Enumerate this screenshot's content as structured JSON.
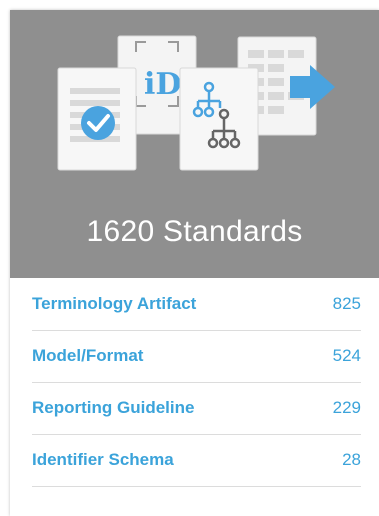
{
  "header": {
    "title": "1620 Standards",
    "background": "#8f8f8f",
    "illustration_icons": [
      "document-check-icon",
      "identifier-icon",
      "hierarchy-icon",
      "table-arrow-icon"
    ],
    "accent_color": "#4aa3df"
  },
  "categories": [
    {
      "label": "Terminology Artifact",
      "count": "825"
    },
    {
      "label": "Model/Format",
      "count": "524"
    },
    {
      "label": "Reporting Guideline",
      "count": "229"
    },
    {
      "label": "Identifier Schema",
      "count": "28"
    }
  ],
  "link_color": "#3ba3da"
}
